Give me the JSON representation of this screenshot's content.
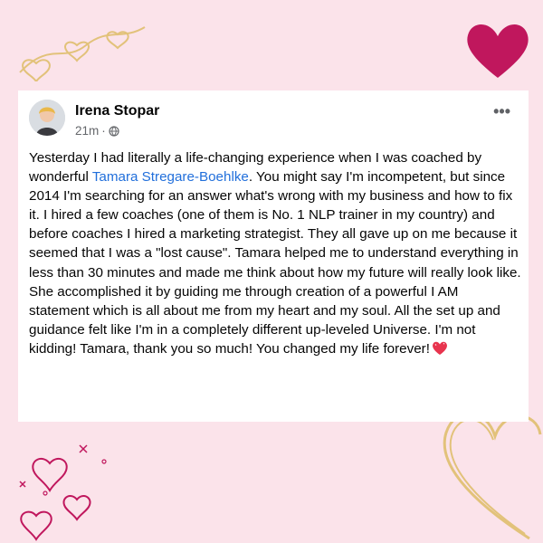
{
  "post": {
    "author": "Irena Stopar",
    "time": "21m",
    "separator": "·",
    "privacy_icon": "globe-icon",
    "more_icon": "ellipsis-icon",
    "body_before": "Yesterday I had literally a life-changing experience when I was coached by wonderful ",
    "mention": "Tamara Stregare-Boehlke",
    "body_after": ". You might say I'm incompetent, but since 2014 I'm searching for an answer what's wrong with my business and how to fix it. I hired a few coaches (one of them is No. 1 NLP trainer in my country) and before coaches I hired a marketing strategist. They all gave up on me because it seemed that I was a \"lost cause\". Tamara helped me to understand everything in less than 30 minutes and made me think about how my future will really look like. She accomplished it by guiding me through creation of a powerful I AM statement which is all about me from my heart and my soul.  All the set up and guidance felt like I'm in a completely different up-leveled Universe. I'm not kidding! Tamara, thank you so much! You changed my life forever!",
    "end_emoji": "sparkling-heart-icon"
  },
  "colors": {
    "background": "#fbe3ea",
    "accent_heart": "#c0175d",
    "gold": "#e2c27a",
    "mention": "#216fdb"
  },
  "decorations": [
    "gold-swirl-hearts-icon",
    "magenta-heart-icon",
    "gold-heart-outline-icon",
    "magenta-hearts-doodle-icon"
  ]
}
